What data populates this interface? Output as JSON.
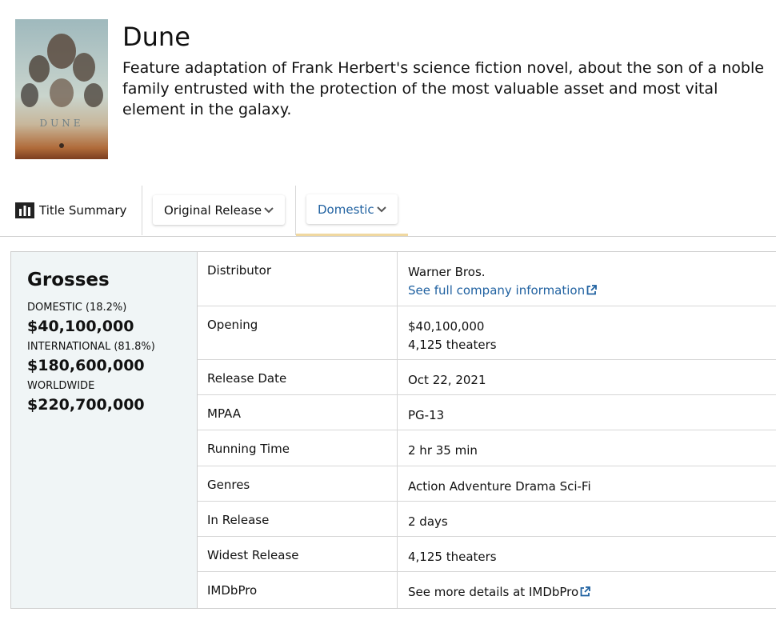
{
  "movie": {
    "title": "Dune",
    "description": "Feature adaptation of Frank Herbert's science fiction novel, about the son of a noble family entrusted with the protection of the most valuable asset and most vital element in the galaxy."
  },
  "tabs": {
    "title_summary": "Title Summary",
    "release_dropdown": "Original Release",
    "region_dropdown": "Domestic"
  },
  "grosses": {
    "heading": "Grosses",
    "domestic_label": "DOMESTIC (18.2%)",
    "domestic_value": "$40,100,000",
    "international_label": "INTERNATIONAL (81.8%)",
    "international_value": "$180,600,000",
    "worldwide_label": "WORLDWIDE",
    "worldwide_value": "$220,700,000"
  },
  "details": {
    "distributor": {
      "label": "Distributor",
      "value": "Warner Bros.",
      "link": "See full company information"
    },
    "opening": {
      "label": "Opening",
      "value": "$40,100,000",
      "value2": "4,125 theaters"
    },
    "release_date": {
      "label": "Release Date",
      "value": "Oct 22, 2021"
    },
    "mpaa": {
      "label": "MPAA",
      "value": "PG-13"
    },
    "running_time": {
      "label": "Running Time",
      "value": "2 hr 35 min"
    },
    "genres": {
      "label": "Genres",
      "value": "Action Adventure Drama Sci-Fi"
    },
    "in_release": {
      "label": "In Release",
      "value": "2 days"
    },
    "widest_release": {
      "label": "Widest Release",
      "value": "4,125 theaters"
    },
    "imdbpro": {
      "label": "IMDbPro",
      "link": "See more details at IMDbPro"
    }
  },
  "colors": {
    "link": "#2162a1",
    "grosses_bg": "#f0f5f6",
    "tab_underline": "#f0d8a0"
  },
  "icons": {
    "summary": "bar-chart-icon",
    "dropdown": "chevron-down-icon",
    "external": "external-link-icon"
  }
}
